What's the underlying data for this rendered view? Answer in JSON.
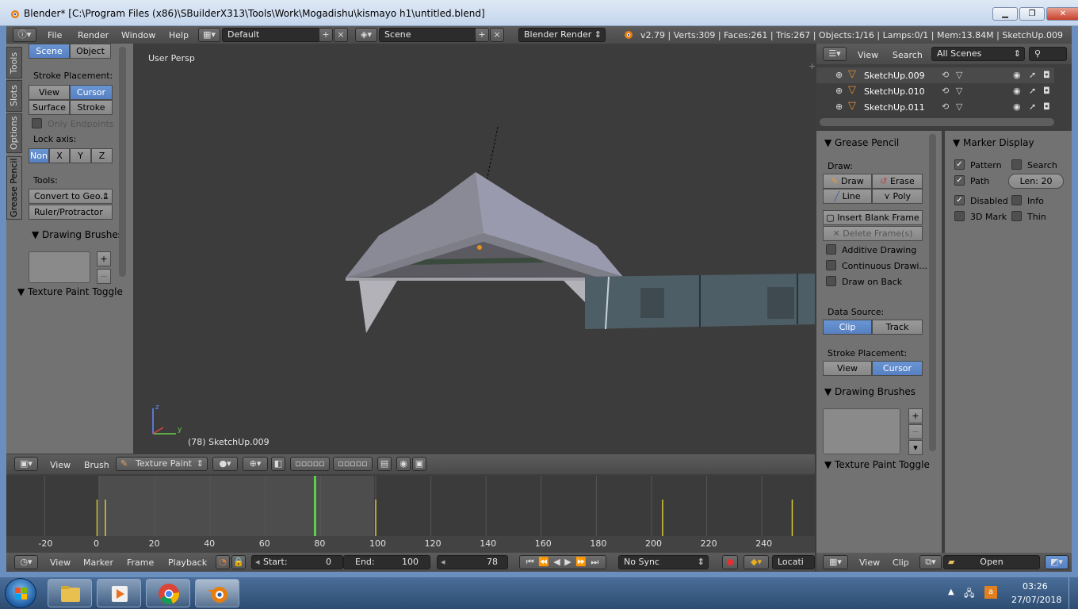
{
  "window": {
    "title": "Blender* [C:\\Program Files (x86)\\SBuilderX313\\Tools\\Work\\Mogadishu\\kismayo h1\\untitled.blend]",
    "min_label": "▁",
    "max_label": "❐",
    "close_label": "✕"
  },
  "info_header": {
    "menus": [
      "File",
      "Render",
      "Window",
      "Help"
    ],
    "layout": "Default",
    "scene": "Scene",
    "engine": "Blender Render",
    "stats": "v2.79 | Verts:309 | Faces:261 | Tris:267 | Objects:1/16 | Lamps:0/1 | Mem:13.84M | SketchUp.009"
  },
  "tool_shelf": {
    "tabs": [
      "Tools",
      "Slots",
      "Options",
      "Grease Pencil"
    ],
    "scene_btn": "Scene",
    "object_btn": "Object",
    "stroke_placement_label": "Stroke Placement:",
    "view_btn": "View",
    "cursor_btn": "Cursor",
    "surface_btn": "Surface",
    "stroke_btn": "Stroke",
    "only_endpoints": "Only Endpoints",
    "lock_axis_label": "Lock axis:",
    "axis_buttons": [
      "Non",
      "X",
      "Y",
      "Z"
    ],
    "tools_label": "Tools:",
    "convert_btn": "Convert to Geo...",
    "ruler_btn": "Ruler/Protractor",
    "drawing_brushes": "Drawing Brushes",
    "texture_paint_toggle": "Texture Paint Toggle"
  },
  "viewport": {
    "label": "User Persp",
    "object_label": "(78) SketchUp.009",
    "axis_z": "z",
    "axis_y": "y"
  },
  "view3d_header": {
    "view": "View",
    "brush": "Brush",
    "mode": "Texture Paint"
  },
  "timeline": {
    "ticks": [
      "-20",
      "0",
      "20",
      "40",
      "60",
      "80",
      "100",
      "120",
      "140",
      "160",
      "180",
      "200",
      "220",
      "240"
    ],
    "current_frame_value": 78,
    "header": {
      "view": "View",
      "marker": "Marker",
      "frame": "Frame",
      "playback": "Playback",
      "start_label": "Start:",
      "start_value": "0",
      "end_label": "End:",
      "end_value": "100",
      "current": "78",
      "sync": "No Sync",
      "keying": "Locati"
    }
  },
  "outliner": {
    "view": "View",
    "search": "Search",
    "filter": "All Scenes",
    "rows": [
      "SketchUp.009",
      "SketchUp.010",
      "SketchUp.011"
    ]
  },
  "clip_tools": {
    "grease_pencil": "Grease Pencil",
    "draw_label": "Draw:",
    "draw_btn": "Draw",
    "erase_btn": "Erase",
    "line_btn": "Line",
    "poly_btn": "Poly",
    "insert_blank": "Insert Blank Frame",
    "delete_frames": "Delete Frame(s)",
    "additive": "Additive Drawing",
    "continuous": "Continuous Drawi...",
    "draw_on_back": "Draw on Back",
    "data_source_label": "Data Source:",
    "clip_btn": "Clip",
    "track_btn": "Track",
    "stroke_placement_label": "Stroke Placement:",
    "view_btn": "View",
    "cursor_btn": "Cursor",
    "drawing_brushes": "Drawing Brushes",
    "texture_paint_toggle": "Texture Paint Toggle"
  },
  "marker_display": {
    "title": "Marker Display",
    "pattern": "Pattern",
    "search": "Search",
    "path": "Path",
    "len": "Len: 20",
    "disabled": "Disabled",
    "info": "Info",
    "mark3d": "3D Mark",
    "thin": "Thin"
  },
  "clip_header": {
    "view": "View",
    "clip": "Clip",
    "open": "Open"
  },
  "taskbar": {
    "time": "03:26",
    "date": "27/07/2018"
  }
}
